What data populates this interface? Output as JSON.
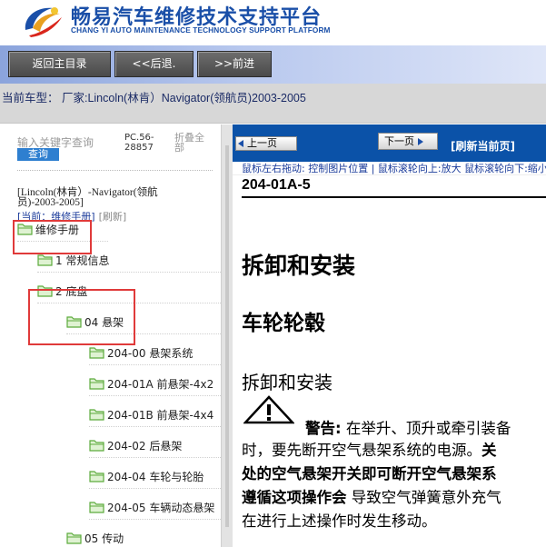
{
  "header": {
    "title_cn": "畅易汽车维修技术支持平台",
    "title_en": "CHANG YI AUTO MAINTENANCE TECHNOLOGY SUPPORT PLATFORM",
    "logo_icon": "cy-logo-icon"
  },
  "toolbar": {
    "home_label": "返回主目录",
    "back_label": "<<后退.",
    "forward_label": ">>前进"
  },
  "vehicle": {
    "text": "当前车型： 厂家:Lincoln(林肯）Navigator(领航员)2003-2005"
  },
  "left": {
    "search_placeholder": "输入关键字查询",
    "search_button": "查询",
    "pc_info": "PC.56-28857",
    "collapse_all": "折叠全部",
    "path": "[Lincoln(林肯）-Navigator(领航员)-2003-2005]",
    "current": "[当前：维修手册]",
    "refresh": "[刷新]",
    "tree": [
      {
        "label": "维修手册",
        "level": 0
      },
      {
        "label": "1 常规信息",
        "level": 1
      },
      {
        "label": "2 底盘",
        "level": 1
      },
      {
        "label": "04 悬架",
        "level": 2
      },
      {
        "label": "204-00 悬架系统",
        "level": 3
      },
      {
        "label": "204-01A 前悬架-4x2",
        "level": 3
      },
      {
        "label": "204-01B 前悬架-4x4",
        "level": 3
      },
      {
        "label": "204-02 后悬架",
        "level": 3
      },
      {
        "label": "204-04 车轮与轮胎",
        "level": 3
      },
      {
        "label": "204-05 车辆动态悬架",
        "level": 3
      },
      {
        "label": "05 传动",
        "level": 2
      }
    ]
  },
  "right": {
    "prev_label": "上一页",
    "next_label": "下一页",
    "refresh_label": "[刷新当前页]",
    "hint": "鼠标左右拖动: 控制图片位置 | 鼠标滚轮向上:放大  鼠标滚轮向下:缩小",
    "doc": {
      "code": "204-01A-5",
      "h1": "拆卸和安装",
      "h2": "车轮轮毂",
      "h3": "拆卸和安装",
      "warn_label": "警告:",
      "line1": " 在举升、顶升或牵引装备",
      "line2_a": "时，要先断开空气悬架系统的电源。",
      "line2_b": "关",
      "line3": "处的空气悬架开关即可断开空气悬架系",
      "line4_a": "遵循这项操作会",
      "line4_b": " 导致空气弹簧意外充气",
      "line5": "在进行上述操作时发生移动。"
    }
  },
  "colors": {
    "brand_blue": "#1a4fa8",
    "highlight_red": "#e03a3a",
    "right_header": "#0b52a8",
    "folder_green": "#5cab3c"
  }
}
